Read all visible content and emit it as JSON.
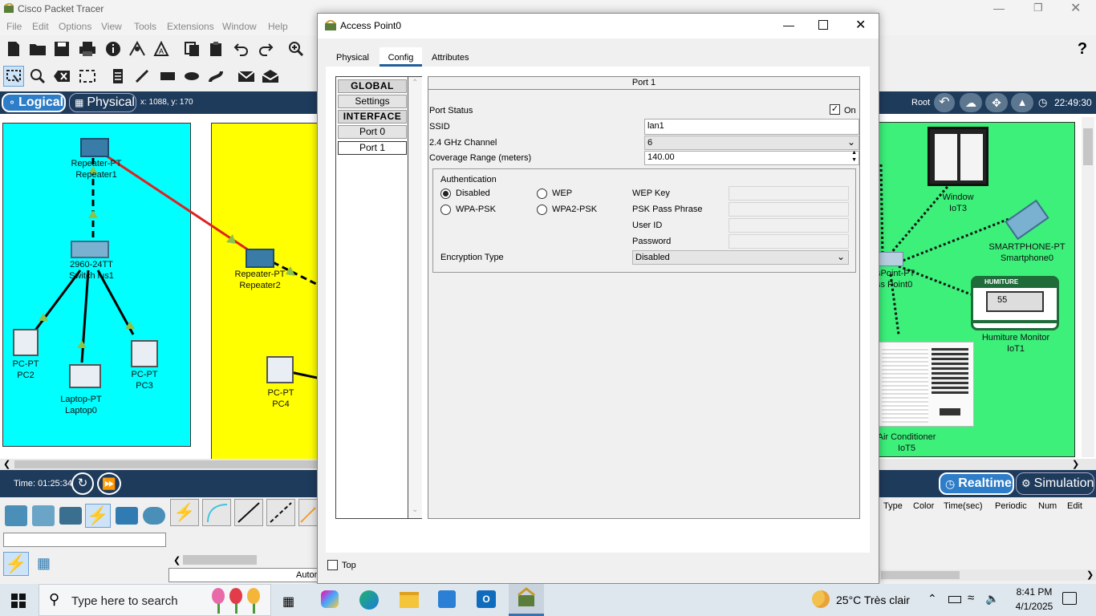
{
  "app": {
    "title": "Cisco Packet Tracer"
  },
  "menu": [
    "File",
    "Edit",
    "Options",
    "View",
    "Tools",
    "Extensions",
    "Window",
    "Help"
  ],
  "nav": {
    "logical": "Logical",
    "physical": "Physical",
    "coords": "x: 1088, y: 170",
    "root": "Root",
    "clock": "22:49:30"
  },
  "devices": {
    "repeater1": {
      "type": "Repeater-PT",
      "name": "Repeater1"
    },
    "switch": {
      "type": "2960-24TT",
      "name": "Switch ius1"
    },
    "pc2": {
      "type": "PC-PT",
      "name": "PC2"
    },
    "laptop0": {
      "type": "Laptop-PT",
      "name": "Laptop0"
    },
    "pc3": {
      "type": "PC-PT",
      "name": "PC3"
    },
    "repeater2": {
      "type": "Repeater-PT",
      "name": "Repeater2"
    },
    "pc4": {
      "type": "PC-PT",
      "name": "PC4"
    },
    "window_iot": {
      "type": "Window",
      "name": "IoT3"
    },
    "smartphone": {
      "type": "SMARTPHONE-PT",
      "name": "Smartphone0"
    },
    "accesspoint": {
      "type": "sPoint-PT",
      "name": "ss Point0"
    },
    "humiture": {
      "type": "Humiture Monitor",
      "name": "IoT1",
      "header": "HUMITURE",
      "value": "55"
    },
    "aircon": {
      "type": "Air Conditioner",
      "name": "IoT5"
    }
  },
  "bottom": {
    "time": "Time: 01:25:34",
    "realtime": "Realtime",
    "simulation": "Simulation",
    "auto_label": "Autor",
    "event_cols": [
      "Type",
      "Color",
      "Time(sec)",
      "Periodic",
      "Num",
      "Edit"
    ]
  },
  "dialog": {
    "title": "Access Point0",
    "tabs": [
      "Physical",
      "Config",
      "Attributes"
    ],
    "sidebar": {
      "global": "GLOBAL",
      "settings": "Settings",
      "interface": "INTERFACE",
      "port0": "Port 0",
      "port1": "Port 1"
    },
    "panel": {
      "title": "Port 1",
      "port_status_label": "Port Status",
      "port_status_on": "On",
      "ssid_label": "SSID",
      "ssid_value": "lan1",
      "channel_label": "2.4 GHz Channel",
      "channel_value": "6",
      "coverage_label": "Coverage Range (meters)",
      "coverage_value": "140.00",
      "auth_title": "Authentication",
      "auth_disabled": "Disabled",
      "auth_wep": "WEP",
      "auth_wpapsk": "WPA-PSK",
      "auth_wpa2psk": "WPA2-PSK",
      "wep_key_label": "WEP Key",
      "psk_label": "PSK Pass Phrase",
      "userid_label": "User ID",
      "password_label": "Password",
      "enc_label": "Encryption Type",
      "enc_value": "Disabled"
    },
    "top_label": "Top"
  },
  "taskbar": {
    "search_placeholder": "Type here to search",
    "weather": "25°C  Très clair",
    "time": "8:41 PM",
    "date": "4/1/2025"
  }
}
